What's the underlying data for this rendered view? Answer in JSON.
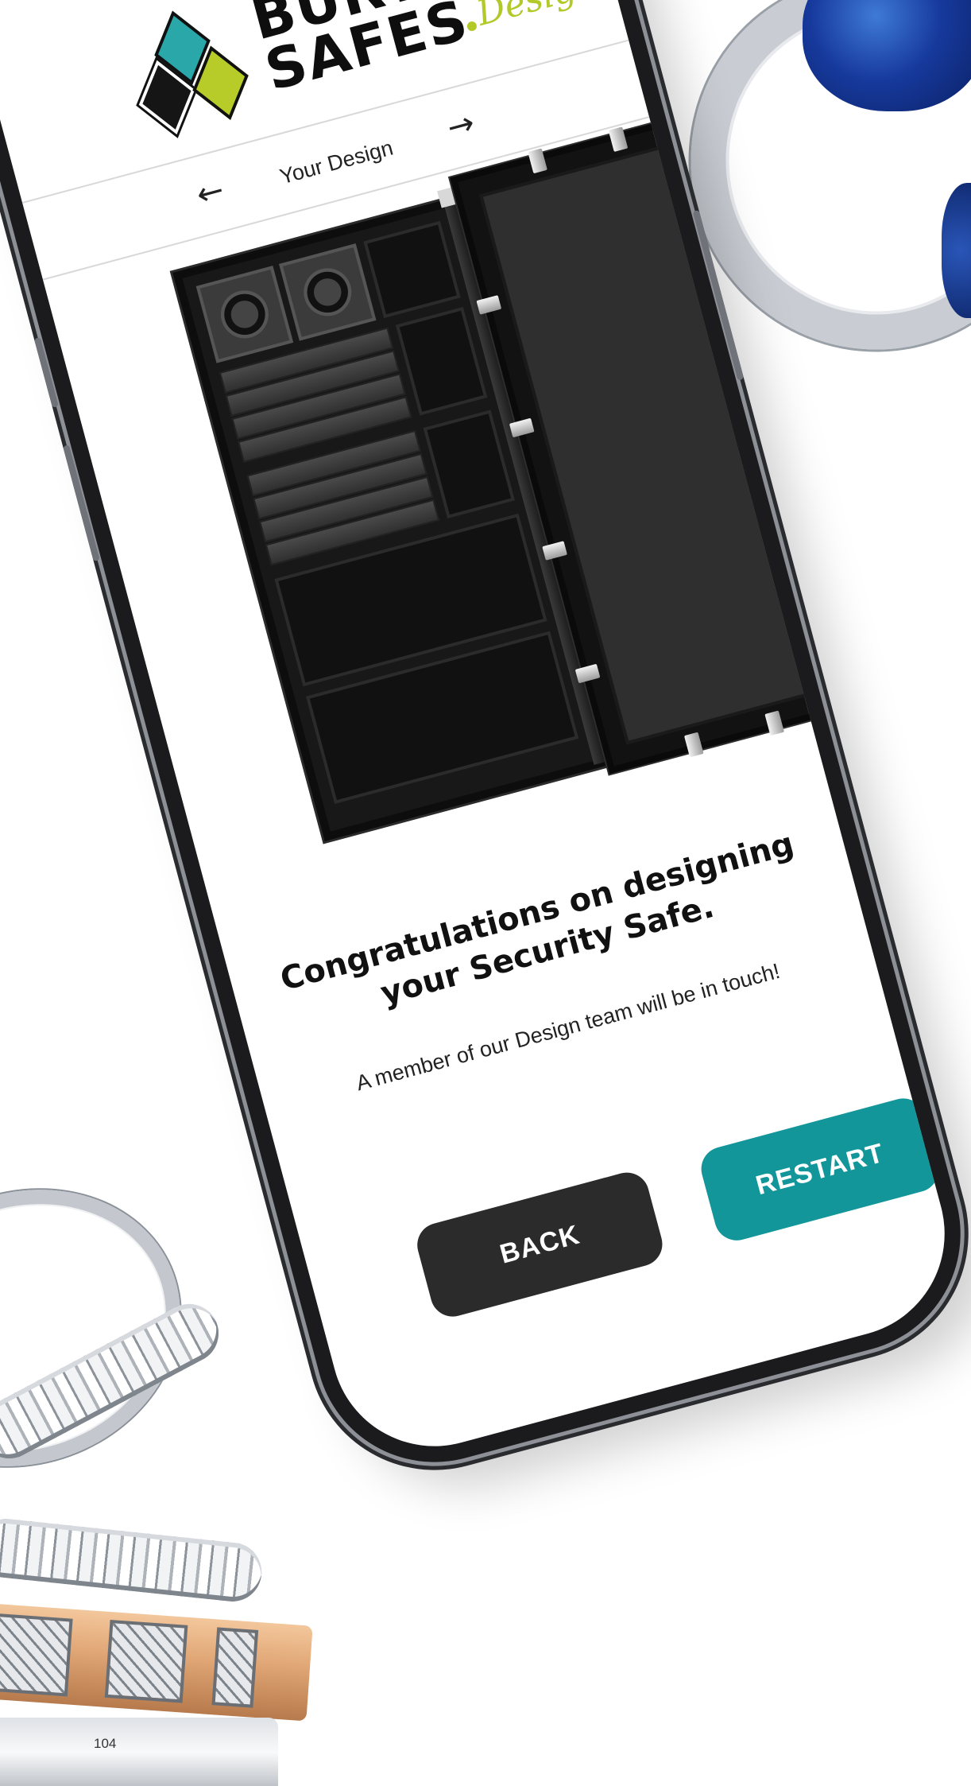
{
  "brand": {
    "line1": "BURTON",
    "line2": "SAFES",
    "script": "Design"
  },
  "nav": {
    "title": "Your Design",
    "back_arrow": "←",
    "forward_arrow": "→"
  },
  "message": {
    "headline": "Congratulations on designing your Security Safe.",
    "subtext": "A member of our Design team will be in touch!"
  },
  "buttons": {
    "back_label": "BACK",
    "restart_label": "RESTART"
  },
  "page_number": "104",
  "colors": {
    "accent_teal": "#12969a",
    "brand_lime": "#b3c92a",
    "dark_button": "#2b2b2b"
  },
  "icons": {
    "back": "arrow-left-icon",
    "forward": "arrow-right-icon"
  }
}
